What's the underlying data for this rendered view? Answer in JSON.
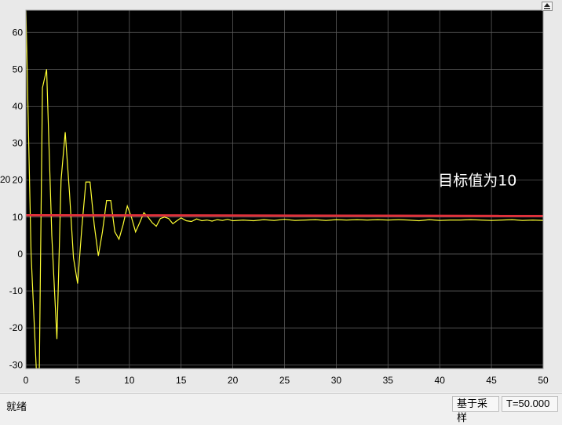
{
  "status": {
    "left_text": "就绪",
    "sample_mode": "基于采样",
    "time": "T=50.000"
  },
  "toolbar": {
    "autoscale_icon": "arrow-up-icon"
  },
  "colors": {
    "plot_bg": "#000000",
    "grid": "#5a5a5a",
    "tick_text": "#e0e0e0",
    "signal": "#ffff33",
    "target": "#e0303a",
    "annotation": "#ffffff"
  },
  "chart_data": {
    "type": "line",
    "xlim": [
      0,
      50
    ],
    "ylim": [
      -31,
      66
    ],
    "xticks": [
      0,
      5,
      10,
      15,
      20,
      25,
      30,
      35,
      40,
      45,
      50
    ],
    "yticks": [
      -30,
      -20,
      -10,
      0,
      10,
      20,
      30,
      40,
      50,
      60
    ],
    "grid": true,
    "edge_label": "20",
    "series": [
      {
        "type": "line",
        "color": "#ffff33",
        "x": [
          0,
          0.2,
          0.5,
          1,
          1.3,
          1.6,
          2,
          2.5,
          3,
          3.4,
          3.8,
          4.2,
          4.6,
          5,
          5.4,
          5.8,
          6.2,
          6.6,
          7,
          7.4,
          7.8,
          8.2,
          8.6,
          9,
          9.4,
          9.8,
          10.2,
          10.6,
          11,
          11.4,
          11.8,
          12.2,
          12.6,
          13,
          13.4,
          13.8,
          14.2,
          14.6,
          15,
          15.5,
          16,
          16.5,
          17,
          17.5,
          18,
          18.5,
          19,
          19.5,
          20,
          21,
          22,
          23,
          24,
          25,
          26,
          27,
          28,
          29,
          30,
          31,
          32,
          33,
          34,
          35,
          36,
          37,
          38,
          39,
          40,
          41,
          42,
          43,
          44,
          45,
          46,
          47,
          48,
          49,
          50
        ],
        "y": [
          66,
          40,
          0,
          -31,
          -31,
          45,
          50,
          5,
          -23,
          20,
          33,
          17,
          -1,
          -8,
          7,
          19.5,
          19.5,
          8,
          -0.5,
          6,
          14.5,
          14.5,
          6,
          4,
          8,
          13,
          10,
          6,
          8.5,
          11.2,
          10,
          8.5,
          7.5,
          9.6,
          10,
          9.6,
          8.2,
          9,
          9.8,
          9,
          8.8,
          9.5,
          9,
          9.2,
          8.9,
          9.3,
          9.1,
          9.4,
          9,
          9.2,
          9.0,
          9.3,
          9.1,
          9.4,
          9.1,
          9.2,
          9.3,
          9.1,
          9.3,
          9.2,
          9.3,
          9.2,
          9.3,
          9.2,
          9.3,
          9.2,
          9.0,
          9.3,
          9.1,
          9.2,
          9.2,
          9.3,
          9.2,
          9.1,
          9.2,
          9.3,
          9.1,
          9.2,
          9.1
        ]
      },
      {
        "type": "line",
        "color": "#e0303a",
        "x": [
          0,
          50
        ],
        "y": [
          10.5,
          10.3
        ]
      }
    ],
    "annotations": [
      {
        "text": "目标值为10",
        "x": 40,
        "y": 20,
        "color": "#ffffff"
      }
    ]
  }
}
